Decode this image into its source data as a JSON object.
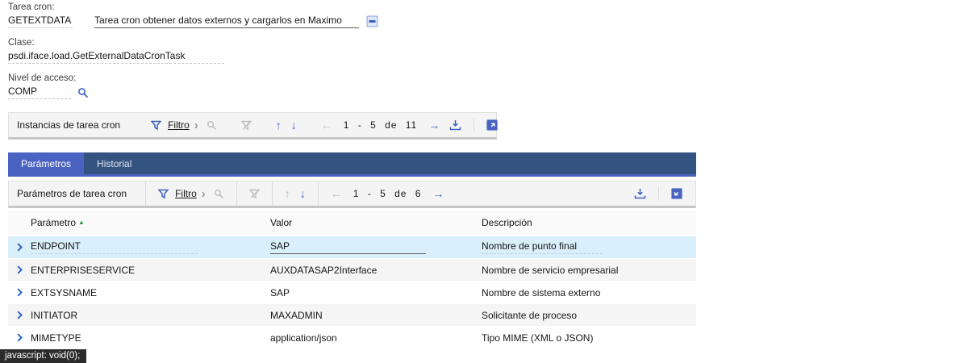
{
  "fields": {
    "task_label": "Tarea cron:",
    "task_value": "GETEXTDATA",
    "task_description": "Tarea cron obtener datos externos y cargarlos en Maximo",
    "class_label": "Clase:",
    "class_value": "psdi.iface.load.GetExternalDataCronTask",
    "access_label": "Nivel de acceso:",
    "access_value": "COMP"
  },
  "toolbar_instances": {
    "title": "Instancias de tarea cron",
    "filter_label": "Filtro",
    "pagination": "1 - 5 de 11"
  },
  "toolbar_params": {
    "title": "Parámetros de tarea cron",
    "filter_label": "Filtro",
    "pagination": "1 - 5 de 6"
  },
  "tabs": [
    {
      "label": "Parámetros",
      "active": true
    },
    {
      "label": "Historial",
      "active": false
    }
  ],
  "table": {
    "columns": [
      "Parámetro",
      "Valor",
      "Descripción"
    ],
    "rows": [
      {
        "param": "ENDPOINT",
        "value": "SAP",
        "desc": "Nombre de punto final",
        "selected": true
      },
      {
        "param": "ENTERPRISESERVICE",
        "value": "AUXDATASAP2Interface",
        "desc": "Nombre de servicio empresarial",
        "selected": false
      },
      {
        "param": "EXTSYSNAME",
        "value": "SAP",
        "desc": "Nombre de sistema externo",
        "selected": false
      },
      {
        "param": "INITIATOR",
        "value": "MAXADMIN",
        "desc": "Solicitante de proceso",
        "selected": false
      },
      {
        "param": "MIMETYPE",
        "value": "application/json",
        "desc": "Tipo MIME (XML o JSON)",
        "selected": false
      }
    ]
  },
  "icons": {
    "up_arrow": "↑",
    "down_arrow": "↓",
    "prev_arrow": "←",
    "next_arrow": "→",
    "expand_chevron": "›",
    "sort_asc": "▲"
  },
  "status_bar": {
    "text": "javascript: void(0);"
  },
  "colors": {
    "accent_blue": "#3d5fc0",
    "tab_bar": "#345380",
    "tab_active": "#4a63c0",
    "selected_row": "#d9effb",
    "alt_row": "#f5f5f5",
    "toolbar_bg": "#f4f4f4",
    "status_bg": "#2b2b2b",
    "sort_green": "#2f9e44"
  }
}
